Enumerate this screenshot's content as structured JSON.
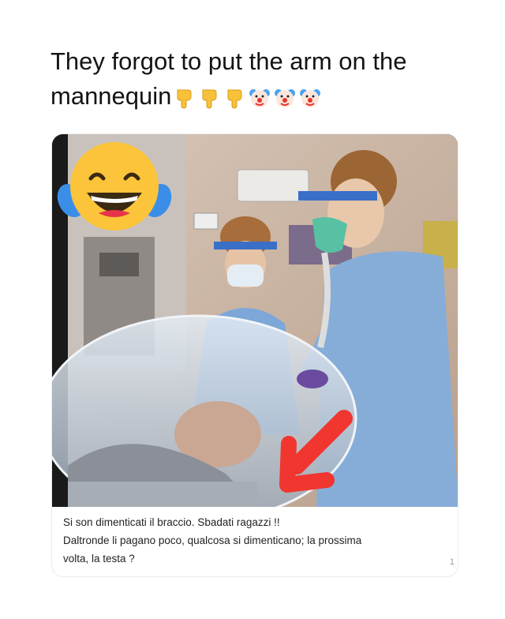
{
  "post": {
    "title_line1": "They forgot to put the arm on the",
    "title_line2": "mannequin",
    "emojis": [
      "pointing-down-icon",
      "pointing-down-icon",
      "pointing-down-icon",
      "clown-face-icon",
      "clown-face-icon",
      "clown-face-icon"
    ]
  },
  "card": {
    "photo_overlay_emoji": "laughing-with-tears-icon",
    "caption_line1": "Si son dimenticati il braccio.  Sbadati ragazzi !!",
    "caption_line2": "Daltronde li pagano poco,  qualcosa si dimenticano; la prossima",
    "caption_line3": "volta, la testa ?",
    "corner_mark": "1",
    "arrow_color": "#f0362e"
  }
}
